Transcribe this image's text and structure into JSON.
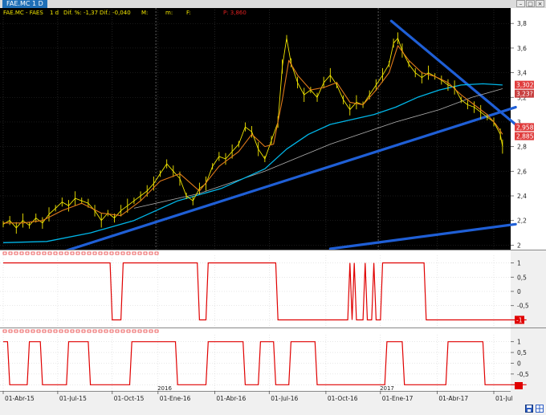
{
  "window": {
    "title": "FAE.MC 1 D",
    "controls": [
      "–",
      "□",
      "×"
    ]
  },
  "header": {
    "symbol": "FAE.MC - FAES",
    "period": "1 d",
    "dif_pct": "Dif. %: -1,37",
    "dif": "Dif.: -0,040",
    "m_label": "M:",
    "m2_label": "m:",
    "f_label": "F:",
    "p_label": "P: 3,860"
  },
  "colors": {
    "background": "#000000",
    "price": "#f2e600",
    "fast_ma": "#e07a1a",
    "mid_ma": "#00b6e8",
    "slow_ma": "#b0b0b0",
    "trendline": "#1f5fd6",
    "indicator": "#e00000",
    "axis_tag": "#e03c3c"
  },
  "price_tags": [
    "3,302",
    "3,23?",
    "2,958",
    "2,885"
  ],
  "bottom_icons": [
    "save-icon",
    "grid-icon"
  ],
  "chart_data": [
    {
      "type": "line",
      "panel": "price",
      "x_ticks": [
        "01-Abr-15",
        "01-Jul-15",
        "01-Oct-15",
        "2016",
        "01-Ene-16",
        "01-Abr-16",
        "01-Jul-16",
        "01-Oct-16",
        "2017",
        "01-Ene-17",
        "01-Abr-17",
        "01-Jul"
      ],
      "y_ticks": [
        "2",
        "2,2",
        "2,4",
        "2,6",
        "2,8",
        "3",
        "3,2",
        "3,4",
        "3,6",
        "3,8"
      ],
      "ylim": [
        1.97,
        3.86
      ],
      "series": [
        {
          "key": "price",
          "values": [
            [
              0,
              2.17
            ],
            [
              3,
              2.2
            ],
            [
              6,
              2.14
            ],
            [
              9,
              2.2
            ],
            [
              12,
              2.16
            ],
            [
              15,
              2.22
            ],
            [
              18,
              2.18
            ],
            [
              21,
              2.25
            ],
            [
              24,
              2.3
            ],
            [
              27,
              2.35
            ],
            [
              30,
              2.32
            ],
            [
              33,
              2.38
            ],
            [
              36,
              2.36
            ],
            [
              39,
              2.34
            ],
            [
              42,
              2.28
            ],
            [
              45,
              2.2
            ],
            [
              48,
              2.26
            ],
            [
              51,
              2.22
            ],
            [
              54,
              2.28
            ],
            [
              57,
              2.32
            ],
            [
              60,
              2.36
            ],
            [
              63,
              2.4
            ],
            [
              66,
              2.44
            ],
            [
              69,
              2.5
            ],
            [
              72,
              2.58
            ],
            [
              75,
              2.66
            ],
            [
              78,
              2.6
            ],
            [
              81,
              2.54
            ],
            [
              84,
              2.4
            ],
            [
              87,
              2.36
            ],
            [
              90,
              2.46
            ],
            [
              93,
              2.5
            ],
            [
              96,
              2.64
            ],
            [
              99,
              2.72
            ],
            [
              102,
              2.7
            ],
            [
              105,
              2.76
            ],
            [
              108,
              2.82
            ],
            [
              111,
              2.96
            ],
            [
              114,
              2.92
            ],
            [
              117,
              2.78
            ],
            [
              120,
              2.7
            ],
            [
              123,
              2.85
            ],
            [
              126,
              3.0
            ],
            [
              128,
              3.45
            ],
            [
              130,
              3.68
            ],
            [
              132,
              3.48
            ],
            [
              135,
              3.32
            ],
            [
              138,
              3.22
            ],
            [
              141,
              3.26
            ],
            [
              144,
              3.2
            ],
            [
              147,
              3.32
            ],
            [
              150,
              3.38
            ],
            [
              153,
              3.3
            ],
            [
              156,
              3.18
            ],
            [
              159,
              3.1
            ],
            [
              162,
              3.16
            ],
            [
              165,
              3.14
            ],
            [
              168,
              3.22
            ],
            [
              171,
              3.3
            ],
            [
              174,
              3.38
            ],
            [
              177,
              3.47
            ],
            [
              179,
              3.64
            ],
            [
              181,
              3.68
            ],
            [
              183,
              3.58
            ],
            [
              186,
              3.47
            ],
            [
              189,
              3.4
            ],
            [
              192,
              3.36
            ],
            [
              195,
              3.4
            ],
            [
              198,
              3.37
            ],
            [
              201,
              3.34
            ],
            [
              204,
              3.3
            ],
            [
              207,
              3.28
            ],
            [
              210,
              3.18
            ],
            [
              213,
              3.14
            ],
            [
              216,
              3.12
            ],
            [
              219,
              3.08
            ],
            [
              222,
              3.04
            ],
            [
              225,
              3.0
            ],
            [
              228,
              2.9
            ],
            [
              229,
              2.8
            ]
          ]
        },
        {
          "key": "fast_ma",
          "values": [
            [
              0,
              2.18
            ],
            [
              9,
              2.18
            ],
            [
              18,
              2.2
            ],
            [
              27,
              2.28
            ],
            [
              36,
              2.34
            ],
            [
              45,
              2.26
            ],
            [
              54,
              2.24
            ],
            [
              63,
              2.36
            ],
            [
              72,
              2.52
            ],
            [
              81,
              2.58
            ],
            [
              90,
              2.44
            ],
            [
              99,
              2.64
            ],
            [
              108,
              2.76
            ],
            [
              114,
              2.9
            ],
            [
              120,
              2.8
            ],
            [
              124,
              2.82
            ],
            [
              128,
              3.18
            ],
            [
              131,
              3.5
            ],
            [
              135,
              3.38
            ],
            [
              141,
              3.26
            ],
            [
              147,
              3.28
            ],
            [
              153,
              3.32
            ],
            [
              159,
              3.16
            ],
            [
              165,
              3.14
            ],
            [
              171,
              3.26
            ],
            [
              177,
              3.4
            ],
            [
              181,
              3.62
            ],
            [
              186,
              3.5
            ],
            [
              192,
              3.4
            ],
            [
              198,
              3.37
            ],
            [
              204,
              3.32
            ],
            [
              210,
              3.22
            ],
            [
              216,
              3.14
            ],
            [
              222,
              3.06
            ],
            [
              226,
              2.98
            ],
            [
              229,
              2.9
            ]
          ]
        },
        {
          "key": "mid_ma",
          "values": [
            [
              0,
              2.02
            ],
            [
              20,
              2.03
            ],
            [
              40,
              2.1
            ],
            [
              60,
              2.2
            ],
            [
              80,
              2.36
            ],
            [
              100,
              2.46
            ],
            [
              120,
              2.62
            ],
            [
              130,
              2.78
            ],
            [
              140,
              2.9
            ],
            [
              150,
              2.98
            ],
            [
              160,
              3.02
            ],
            [
              170,
              3.06
            ],
            [
              180,
              3.12
            ],
            [
              190,
              3.2
            ],
            [
              200,
              3.26
            ],
            [
              210,
              3.3
            ],
            [
              220,
              3.31
            ],
            [
              229,
              3.3
            ]
          ]
        },
        {
          "key": "slow_ma",
          "values": [
            [
              60,
              2.3
            ],
            [
              90,
              2.42
            ],
            [
              120,
              2.6
            ],
            [
              150,
              2.82
            ],
            [
              180,
              3.0
            ],
            [
              200,
              3.1
            ],
            [
              215,
              3.2
            ],
            [
              229,
              3.27
            ]
          ]
        }
      ],
      "trendlines": [
        {
          "from": [
            28,
            1.95
          ],
          "to": [
            235,
            3.12
          ]
        },
        {
          "from": [
            178,
            3.82
          ],
          "to": [
            235,
            2.98
          ]
        },
        {
          "from": [
            150,
            1.97
          ],
          "to": [
            235,
            2.17
          ]
        }
      ]
    },
    {
      "type": "line",
      "panel": "indicator-1",
      "y_ticks": [
        "1",
        "0,5",
        "0",
        "-0,5",
        "-1"
      ],
      "ylim": [
        -1.1,
        1.1
      ],
      "last_value": "-1",
      "signal": [
        [
          0,
          1
        ],
        [
          49,
          1
        ],
        [
          50,
          -1
        ],
        [
          54,
          -1
        ],
        [
          55,
          1
        ],
        [
          89,
          1
        ],
        [
          90,
          -1
        ],
        [
          93,
          -1
        ],
        [
          94,
          1
        ],
        [
          125,
          1
        ],
        [
          126,
          -1
        ],
        [
          158,
          -1
        ],
        [
          159,
          1
        ],
        [
          160,
          -1
        ],
        [
          161,
          1
        ],
        [
          162,
          -1
        ],
        [
          165,
          -1
        ],
        [
          166,
          1
        ],
        [
          167,
          -1
        ],
        [
          169,
          -1
        ],
        [
          170,
          1
        ],
        [
          171,
          -1
        ],
        [
          173,
          -1
        ],
        [
          174,
          1
        ],
        [
          193,
          1
        ],
        [
          194,
          -1
        ],
        [
          240,
          -1
        ]
      ]
    },
    {
      "type": "line",
      "panel": "indicator-2",
      "y_ticks": [
        "1",
        "0,5",
        "0",
        "-0,5",
        "-1"
      ],
      "ylim": [
        -1.1,
        1.1
      ],
      "signal": [
        [
          0,
          1
        ],
        [
          2,
          1
        ],
        [
          3,
          -1
        ],
        [
          11,
          -1
        ],
        [
          12,
          1
        ],
        [
          17,
          1
        ],
        [
          18,
          -1
        ],
        [
          29,
          -1
        ],
        [
          30,
          1
        ],
        [
          39,
          1
        ],
        [
          40,
          -1
        ],
        [
          58,
          -1
        ],
        [
          59,
          1
        ],
        [
          79,
          1
        ],
        [
          80,
          -1
        ],
        [
          93,
          -1
        ],
        [
          94,
          1
        ],
        [
          110,
          1
        ],
        [
          111,
          -1
        ],
        [
          117,
          -1
        ],
        [
          118,
          1
        ],
        [
          124,
          1
        ],
        [
          125,
          -1
        ],
        [
          131,
          -1
        ],
        [
          132,
          1
        ],
        [
          143,
          1
        ],
        [
          144,
          -1
        ],
        [
          175,
          -1
        ],
        [
          176,
          1
        ],
        [
          183,
          1
        ],
        [
          184,
          -1
        ],
        [
          203,
          -1
        ],
        [
          204,
          1
        ],
        [
          220,
          1
        ],
        [
          221,
          -1
        ],
        [
          240,
          -1
        ]
      ]
    }
  ]
}
